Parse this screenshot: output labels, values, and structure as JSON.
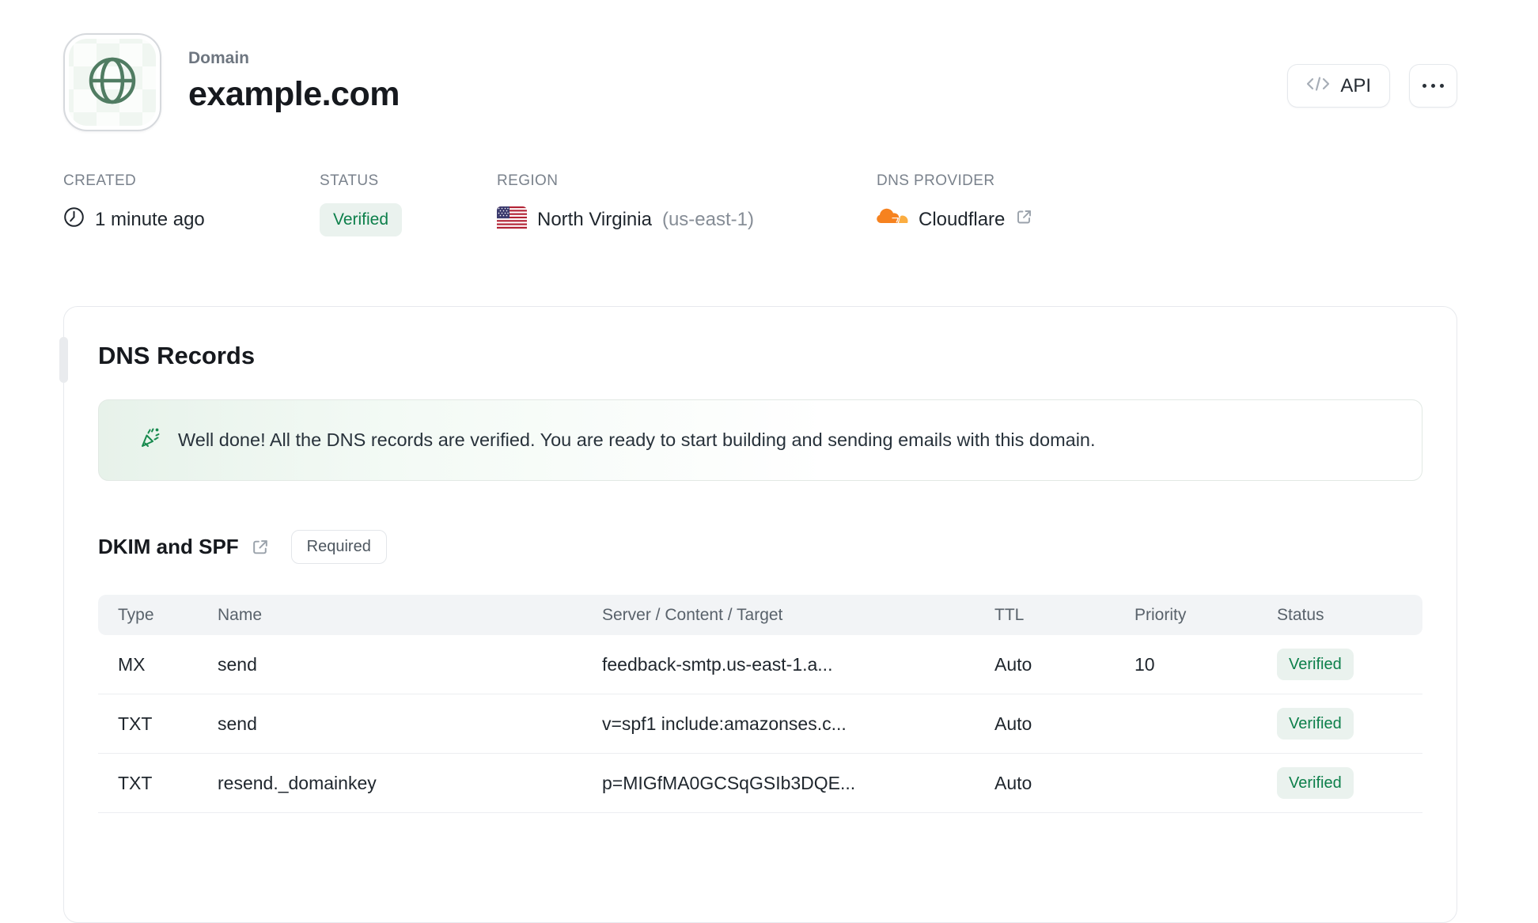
{
  "header": {
    "eyebrow": "Domain",
    "title": "example.com",
    "api_button_label": "API"
  },
  "meta": {
    "created": {
      "label": "CREATED",
      "value": "1 minute ago"
    },
    "status": {
      "label": "STATUS",
      "value": "Verified"
    },
    "region": {
      "label": "REGION",
      "value": "North Virginia",
      "code": "(us-east-1)"
    },
    "dns_provider": {
      "label": "DNS PROVIDER",
      "value": "Cloudflare"
    }
  },
  "dns_records": {
    "title": "DNS Records",
    "success_message": "Well done! All the DNS records are verified. You are ready to start building and sending emails with this domain.",
    "section": {
      "title": "DKIM and SPF",
      "badge": "Required"
    },
    "table": {
      "columns": [
        "Type",
        "Name",
        "Server / Content / Target",
        "TTL",
        "Priority",
        "Status"
      ],
      "rows": [
        {
          "type": "MX",
          "name": "send",
          "content": "feedback-smtp.us-east-1.a...",
          "ttl": "Auto",
          "priority": "10",
          "status": "Verified"
        },
        {
          "type": "TXT",
          "name": "send",
          "content": "v=spf1 include:amazonses.c...",
          "ttl": "Auto",
          "priority": "",
          "status": "Verified"
        },
        {
          "type": "TXT",
          "name": "resend._domainkey",
          "content": "p=MIGfMA0GCSqGSIb3DQE...",
          "ttl": "Auto",
          "priority": "",
          "status": "Verified"
        }
      ]
    }
  },
  "icons": {
    "header": "globe-icon",
    "created": "clock-icon",
    "region": "us-flag-icon",
    "dns_provider": "cloudflare-icon",
    "provider_link": "external-link-icon",
    "api": "code-icon",
    "more": "ellipsis-icon",
    "banner": "party-popper-icon",
    "section_link": "external-link-icon"
  },
  "colors": {
    "success_text": "#0c7f4a",
    "success_bg": "#eaf2ee",
    "banner_green": "#e7f2ea",
    "cloudflare_orange": "#f6821f",
    "cloudflare_orange_light": "#fbad41",
    "globe_green": "#507c62",
    "border": "#e7e9ed",
    "table_header_bg": "#f2f4f6"
  }
}
